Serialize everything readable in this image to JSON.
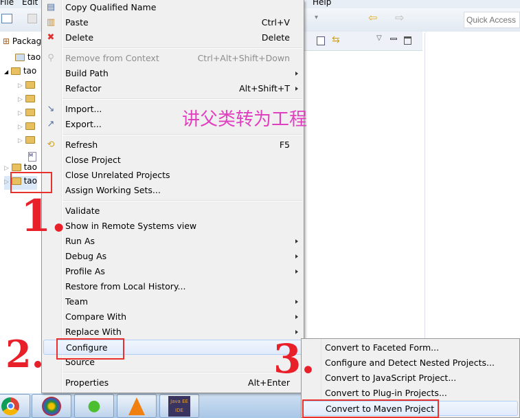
{
  "menubar": {
    "file": "File",
    "edit": "Edit",
    "help": "Help"
  },
  "toolbar": {
    "quick_access_placeholder": "Quick Access"
  },
  "package_explorer": {
    "title": "Packag",
    "items": [
      {
        "label": "tao",
        "type": "maven-module"
      },
      {
        "label": "tao",
        "type": "project",
        "expanded": true
      },
      {
        "label": "",
        "type": "folder"
      },
      {
        "label": "",
        "type": "folder"
      },
      {
        "label": "",
        "type": "folder"
      },
      {
        "label": "",
        "type": "folder"
      },
      {
        "label": "",
        "type": "folder"
      },
      {
        "label": "",
        "type": "pom-file"
      },
      {
        "label": "tao",
        "type": "project"
      },
      {
        "label": "tao",
        "type": "project",
        "selected": true
      }
    ]
  },
  "context_menu": {
    "items": [
      {
        "label": "Copy Qualified Name",
        "icon": "copy-icon"
      },
      {
        "label": "Paste",
        "shortcut": "Ctrl+V",
        "icon": "paste-icon"
      },
      {
        "label": "Delete",
        "shortcut": "Delete",
        "icon": "delete-icon"
      },
      {
        "sep": true
      },
      {
        "label": "Remove from Context",
        "shortcut": "Ctrl+Alt+Shift+Down",
        "disabled": true,
        "icon": "remove-context-icon"
      },
      {
        "label": "Build Path",
        "submenu": true
      },
      {
        "label": "Refactor",
        "shortcut": "Alt+Shift+T",
        "submenu": true
      },
      {
        "sep": true
      },
      {
        "label": "Import...",
        "icon": "import-icon"
      },
      {
        "label": "Export...",
        "icon": "export-icon"
      },
      {
        "sep": true
      },
      {
        "label": "Refresh",
        "shortcut": "F5",
        "icon": "refresh-icon"
      },
      {
        "label": "Close Project"
      },
      {
        "label": "Close Unrelated Projects"
      },
      {
        "label": "Assign Working Sets..."
      },
      {
        "sep": true
      },
      {
        "label": "Validate"
      },
      {
        "label": "Show in Remote Systems view"
      },
      {
        "label": "Run As",
        "submenu": true
      },
      {
        "label": "Debug As",
        "submenu": true
      },
      {
        "label": "Profile As",
        "submenu": true
      },
      {
        "label": "Restore from Local History..."
      },
      {
        "label": "Team",
        "submenu": true
      },
      {
        "label": "Compare With",
        "submenu": true
      },
      {
        "label": "Replace With",
        "submenu": true
      },
      {
        "label": "Configure",
        "submenu": true,
        "highlighted": true
      },
      {
        "label": "Source",
        "submenu": true
      },
      {
        "sep": true
      },
      {
        "label": "Properties",
        "shortcut": "Alt+Enter"
      }
    ]
  },
  "configure_submenu": {
    "items": [
      {
        "label": "Convert to Faceted Form..."
      },
      {
        "label": "Configure and Detect Nested Projects..."
      },
      {
        "label": "Convert to JavaScript Project..."
      },
      {
        "label": "Convert to Plug-in Projects..."
      },
      {
        "label": "Convert to Maven Project",
        "highlighted": true
      }
    ]
  },
  "annotations": {
    "note": "讲父类转为工程",
    "step1": "1.",
    "step2": "2.",
    "step3": "3.",
    "annotation_color": "#e8202a",
    "note_color": "#e040c0"
  },
  "taskbar": {
    "apps": [
      "chrome-icon",
      "browser-icon",
      "wechat-icon",
      "vlc-icon",
      "java-ee-ide-icon"
    ],
    "java_ee_label": "Java EE IDE"
  }
}
